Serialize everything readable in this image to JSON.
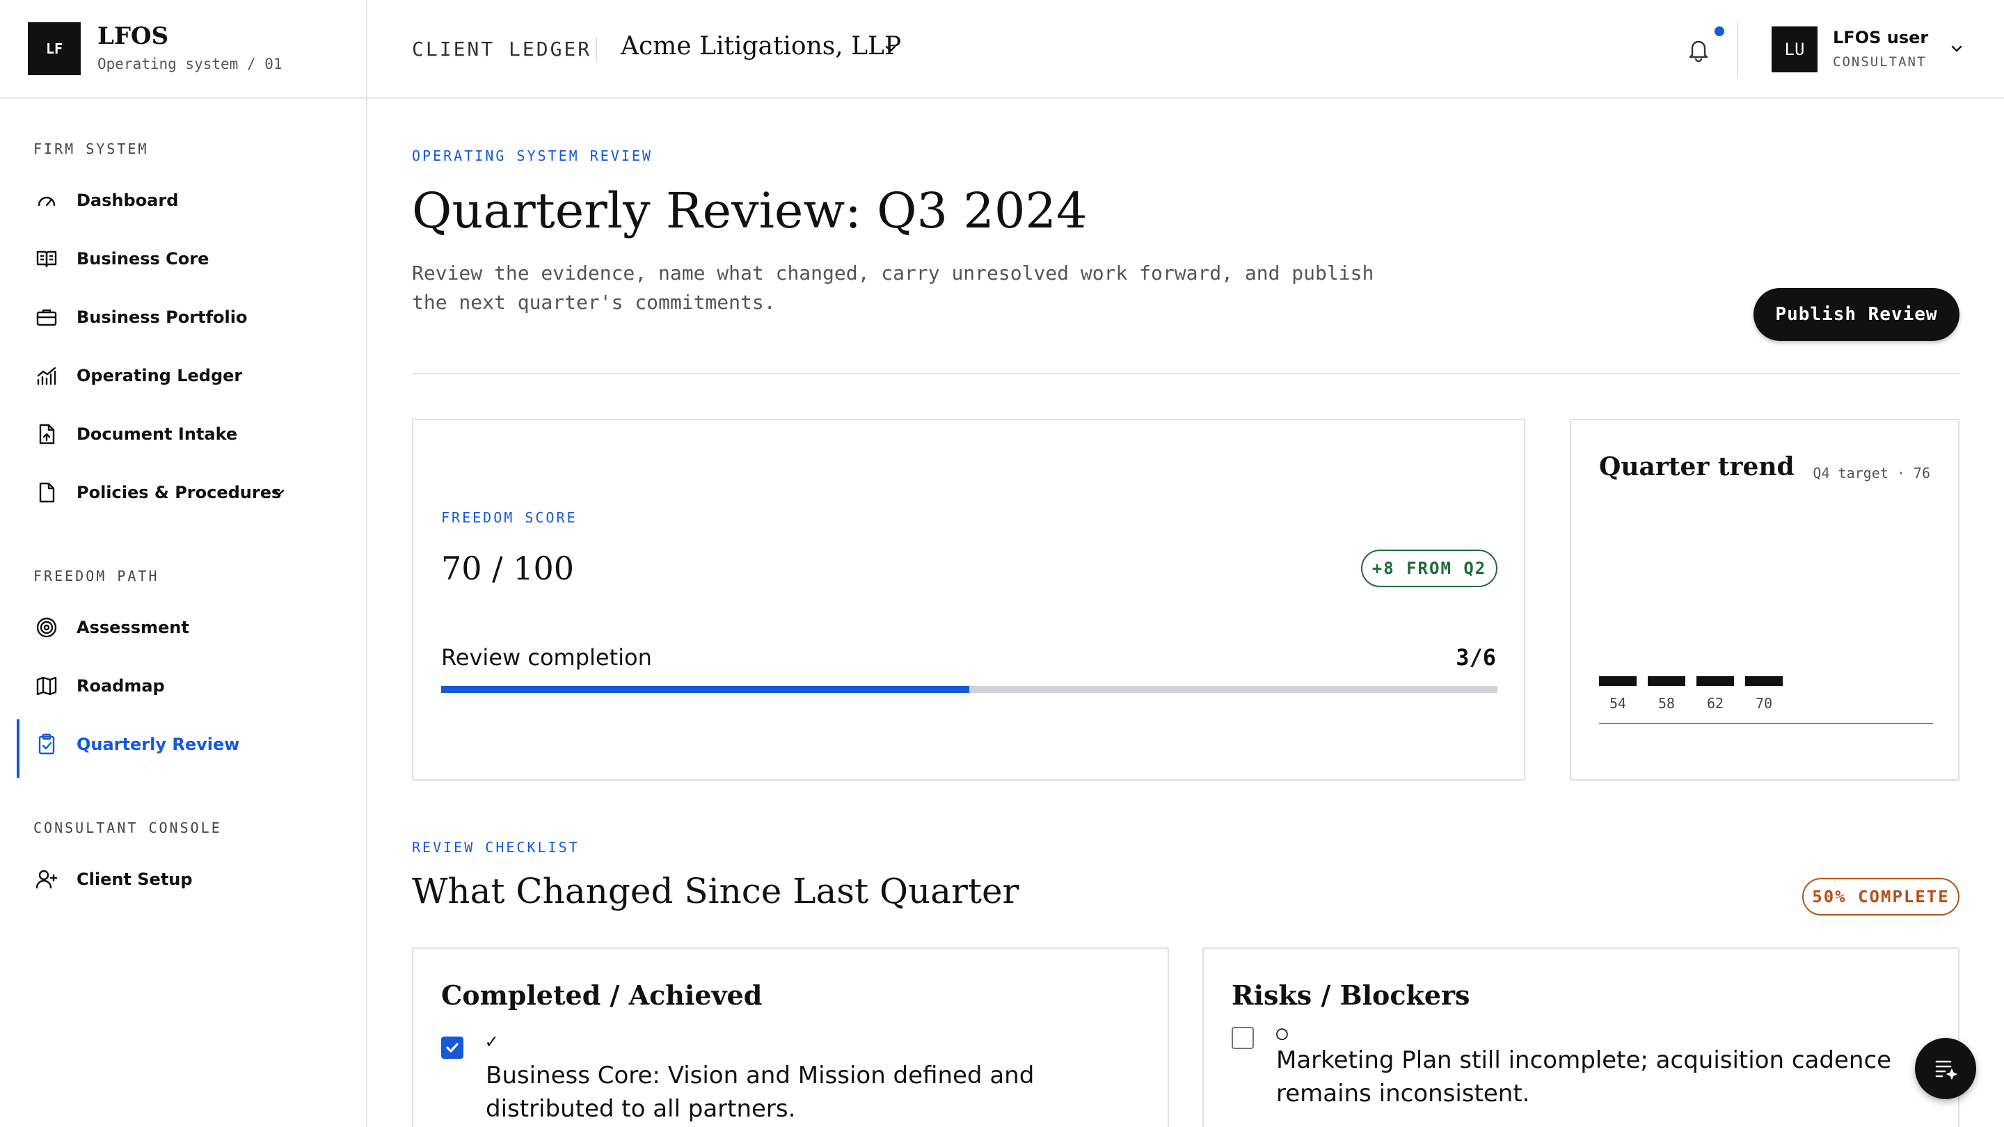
{
  "brand": {
    "logo": "LF",
    "name": "LFOS",
    "subtitle": "Operating system / 01"
  },
  "sidebar": {
    "sections": [
      {
        "title": "FIRM SYSTEM",
        "items": [
          {
            "label": "Dashboard",
            "icon": "gauge-icon"
          },
          {
            "label": "Business Core",
            "icon": "book-icon"
          },
          {
            "label": "Business Portfolio",
            "icon": "briefcase-icon"
          },
          {
            "label": "Operating Ledger",
            "icon": "chart-icon"
          },
          {
            "label": "Document Intake",
            "icon": "document-upload-icon"
          },
          {
            "label": "Policies & Procedures",
            "icon": "file-icon",
            "expandable": true
          }
        ]
      },
      {
        "title": "FREEDOM PATH",
        "items": [
          {
            "label": "Assessment",
            "icon": "target-icon"
          },
          {
            "label": "Roadmap",
            "icon": "map-icon"
          },
          {
            "label": "Quarterly Review",
            "icon": "clipboard-check-icon",
            "active": true
          }
        ]
      },
      {
        "title": "CONSULTANT CONSOLE",
        "items": [
          {
            "label": "Client Setup",
            "icon": "user-plus-icon"
          }
        ]
      }
    ]
  },
  "topbar": {
    "ledger_label": "CLIENT LEDGER",
    "client_name": "Acme Litigations, LLP",
    "notification_unread": true,
    "user": {
      "initials": "LU",
      "name": "LFOS user",
      "role": "CONSULTANT"
    }
  },
  "main": {
    "eyebrow": "OPERATING SYSTEM REVIEW",
    "title": "Quarterly Review: Q3 2024",
    "description": "Review the evidence, name what changed, carry unresolved work forward, and publish the next quarter's commitments.",
    "publish_label": "Publish Review",
    "score": {
      "label": "FREEDOM SCORE",
      "value": "70 / 100",
      "delta": "+8 FROM Q2",
      "review_label": "Review completion",
      "review_count": "3/6",
      "progress_fraction": 0.5
    },
    "trend": {
      "title": "Quarter trend",
      "target": "Q4 target · 76"
    },
    "checklist": {
      "eyebrow": "REVIEW CHECKLIST",
      "title": "What Changed Since Last Quarter",
      "badge": "50% COMPLETE",
      "completed": {
        "title": "Completed / Achieved",
        "mark": "✓",
        "text": "Business Core: Vision and Mission defined and distributed to all partners.",
        "checked": true
      },
      "risks": {
        "title": "Risks / Blockers",
        "mark": "○",
        "text": "Marketing Plan still incomplete; acquisition cadence remains inconsistent.",
        "checked": false
      }
    }
  },
  "chart_data": {
    "type": "bar",
    "categories": [
      "54",
      "58",
      "62",
      "70"
    ],
    "values": [
      54,
      58,
      62,
      70
    ],
    "title": "Quarter trend",
    "xlabel": "",
    "ylabel": "",
    "target_label": "Q4 target · 76",
    "target": 76
  },
  "colors": {
    "accent": "#1559d9",
    "positive": "#1f6b3a",
    "warning": "#b5521a",
    "ink": "#111111"
  }
}
